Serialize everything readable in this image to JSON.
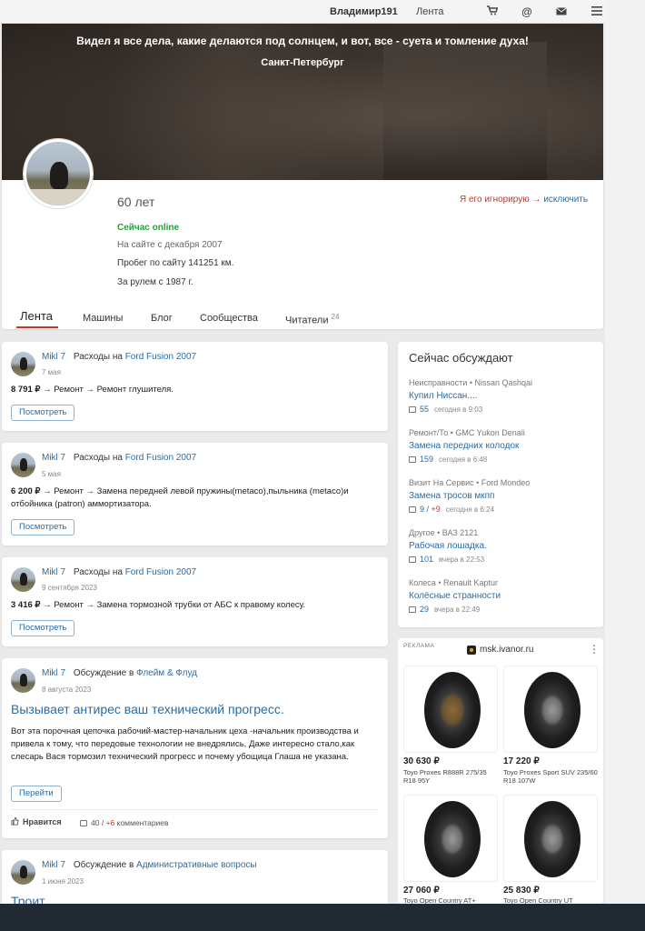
{
  "topbar": {
    "username": "Владимир191",
    "feed": "Лента"
  },
  "hero": {
    "quote": "Видел я все дела, какие делаются под солнцем, и вот, все - суета и томление духа!",
    "city": "Санкт-Петербург"
  },
  "profile": {
    "age": "60 лет",
    "ignore_text": "Я его игнорирую →",
    "ignore_link": "исключить",
    "online": "Сейчас online",
    "since": "На сайте с декабря 2007",
    "mileage": "Пробег по сайту 141251 км.",
    "driving": "За рулем с 1987 г."
  },
  "tabs": [
    {
      "label": "Лента"
    },
    {
      "label": "Машины"
    },
    {
      "label": "Блог"
    },
    {
      "label": "Сообщества"
    },
    {
      "label": "Читатели",
      "count": "24"
    }
  ],
  "feed": [
    {
      "author": "Mikl 7",
      "action": "Расходы на",
      "target": "Ford Fusion 2007",
      "date": "7 мая",
      "amount": "8 791 ₽",
      "text": " → Ремонт → Ремонт глушителя.",
      "button": "Посмотреть"
    },
    {
      "author": "Mikl 7",
      "action": "Расходы на",
      "target": "Ford Fusion 2007",
      "date": "5 мая",
      "amount": "6 200 ₽",
      "text": " → Ремонт → Замена передней левой пружины(metaco),пыльника (metaco)и отбойника (patron) аммортизатора.",
      "button": "Посмотреть"
    },
    {
      "author": "Mikl 7",
      "action": "Расходы на",
      "target": "Ford Fusion 2007",
      "date": "9 сентября 2023",
      "amount": "3 416 ₽",
      "text": " → Ремонт → Замена тормозной трубки от АБС к правому колесу.",
      "button": "Посмотреть"
    },
    {
      "author": "Mikl 7",
      "action": "Обсуждение в",
      "target": "Флейм & Флуд",
      "date": "8 августа 2023",
      "title": "Вызывает антирес ваш технический прогресс.",
      "text": "Вот эта порочная цепочка рабочий-мастер-начальник цеха -начальник производства и привела к тому, что передовые технологии не внедрялись, Даже интересно стало,как слесарь Вася тормозил технический прогресс и почему убощица Глаша не указана.",
      "button": "Перейти",
      "like": "Нравится",
      "comments_total": "40",
      "comments_new": "+6",
      "comments_label": "комментариев"
    },
    {
      "author": "Mikl 7",
      "action": "Обсуждение в",
      "target": "Административные вопросы",
      "date": "1 июня 2023",
      "title": "Троит"
    }
  ],
  "discussions": {
    "title": "Сейчас обсуждают",
    "items": [
      {
        "category": "Неисправности • Nissan Qashqai",
        "title": "Купил Ниссан....",
        "count": "55",
        "new": "",
        "time": "сегодня в 9:03"
      },
      {
        "category": "Ремонт/То • GMC Yukon Denali",
        "title": "Замена передних колодок",
        "count": "159",
        "new": "",
        "time": "сегодня в 6:48"
      },
      {
        "category": "Визит На Сервис • Ford Mondeo",
        "title": "Замена тросов мкпп",
        "count": "9",
        "new": "+9",
        "time": "сегодня в 6:24"
      },
      {
        "category": "Другое • ВАЗ 2121",
        "title": "Рабочая лошадка.",
        "count": "101",
        "new": "",
        "time": "вчера в 22:53"
      },
      {
        "category": "Колеса • Renault Kaptur",
        "title": "Колёсные странности",
        "count": "29",
        "new": "",
        "time": "вчера в 22:49"
      }
    ]
  },
  "ad": {
    "label": "РЕКЛАМА",
    "site": "msk.ivanor.ru",
    "products": [
      {
        "price": "30 630 ₽",
        "name": "Toyo Proxes R888R 275/35 R18 95Y"
      },
      {
        "price": "17 220 ₽",
        "name": "Toyo Proxes Sport SUV 235/60 R18 107W"
      },
      {
        "price": "27 060 ₽",
        "name": "Toyo Open Country AT+"
      },
      {
        "price": "25 830 ₽",
        "name": "Toyo Open Country UT"
      }
    ]
  },
  "icons": [
    "cart-icon",
    "at-icon",
    "mail-icon",
    "menu-icon",
    "comment-icon",
    "like-icon",
    "more-icon"
  ]
}
